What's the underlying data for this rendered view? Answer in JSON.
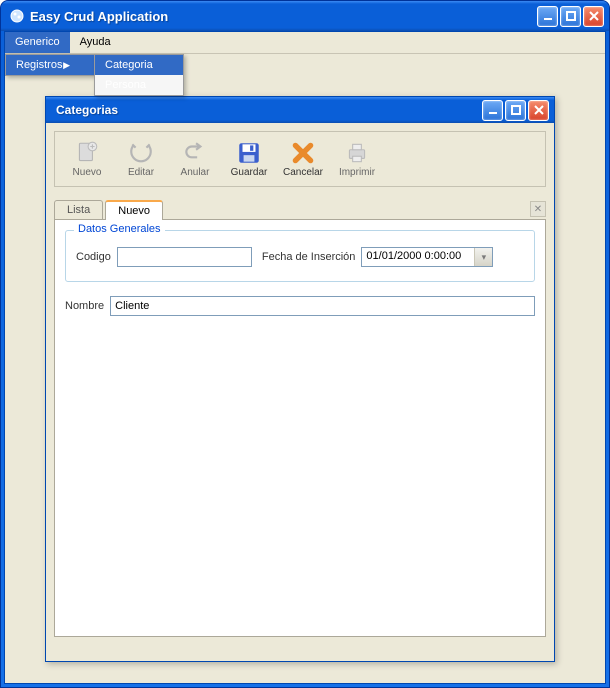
{
  "app": {
    "title": "Easy Crud Application"
  },
  "menubar": {
    "items": [
      "Generico",
      "Ayuda"
    ],
    "dropdown": {
      "registros": "Registros",
      "sub": {
        "categoria": "Categoria",
        "persona": "Persona"
      }
    }
  },
  "child": {
    "title": "Categorias"
  },
  "toolbar": {
    "nuevo": "Nuevo",
    "editar": "Editar",
    "anular": "Anular",
    "guardar": "Guardar",
    "cancelar": "Cancelar",
    "imprimir": "Imprimir"
  },
  "tabs": {
    "lista": "Lista",
    "nuevo": "Nuevo"
  },
  "form": {
    "legend": "Datos Generales",
    "codigo_label": "Codigo",
    "codigo_value": "",
    "fecha_label": "Fecha de Inserción",
    "fecha_value": "01/01/2000 0:00:00",
    "nombre_label": "Nombre",
    "nombre_value": "Cliente"
  }
}
